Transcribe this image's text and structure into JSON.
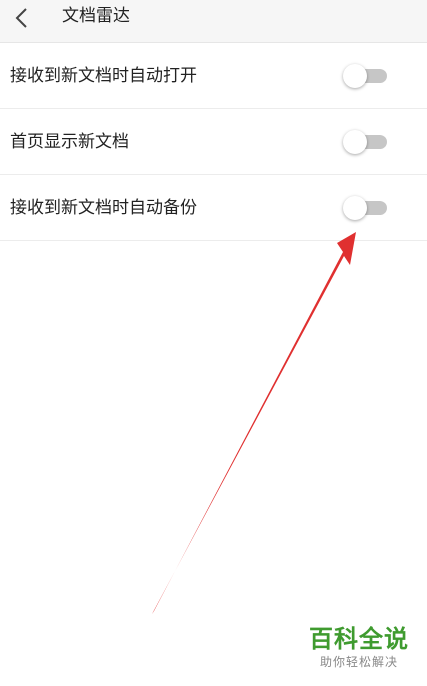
{
  "header": {
    "title": "文档雷达",
    "back_icon": "chevron-left-icon"
  },
  "settings": [
    {
      "label": "接收到新文档时自动打开",
      "enabled": false
    },
    {
      "label": "首页显示新文档",
      "enabled": false
    },
    {
      "label": "接收到新文档时自动备份",
      "enabled": false
    }
  ],
  "annotation": {
    "color": "#e03030"
  },
  "watermark": {
    "title": "百科全说",
    "subtitle": "助你轻松解决",
    "color": "#3f9b2f"
  }
}
